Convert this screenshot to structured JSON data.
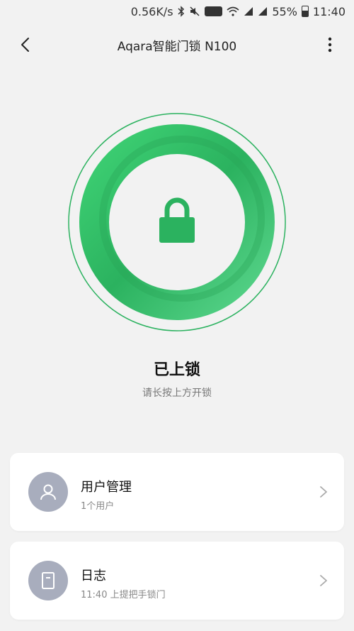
{
  "status_bar": {
    "speed": "0.56K/s",
    "battery": "55%",
    "time": "11:40",
    "icons": [
      "bluetooth-icon",
      "mute-icon",
      "hd-icon",
      "wifi-icon",
      "signal-icon",
      "signal-icon",
      "battery-icon"
    ],
    "hd_label": "HD"
  },
  "header": {
    "title": "Aqara智能门锁 N100",
    "back_icon": "chevron-left-icon",
    "more_icon": "more-vertical-icon"
  },
  "lock": {
    "status": "已上锁",
    "hint": "请长按上方开锁",
    "accent_color": "#2bb25f",
    "icon": "padlock-icon"
  },
  "cards": {
    "users": {
      "title": "用户管理",
      "subtitle": "1个用户",
      "icon": "user-icon"
    },
    "log": {
      "title": "日志",
      "subtitle": "11:40 上提把手锁门",
      "icon": "log-icon"
    }
  }
}
